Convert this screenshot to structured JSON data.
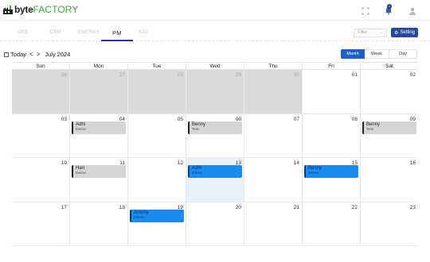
{
  "header": {
    "logo_a": "byte",
    "logo_b": "FACTORY",
    "notification_count": "1"
  },
  "nav": {
    "tabs": [
      "OEE",
      "CBM",
      "ENERGY",
      "PM",
      "SJC"
    ],
    "active_tab": "PM",
    "filter_label": "Filter",
    "setting_label": "Setting"
  },
  "toolbar": {
    "today_label": "Today",
    "prev_label": "<",
    "next_label": ">",
    "month_label": "July 2024",
    "views": [
      "Month",
      "Week",
      "Day"
    ],
    "active_view": "Month"
  },
  "calendar": {
    "weekdays": [
      "Sun",
      "Mon",
      "Tue",
      "Wed",
      "Thu",
      "Fri",
      "Sat"
    ],
    "weeks": [
      [
        {
          "n": "26",
          "other": true
        },
        {
          "n": "27",
          "other": true
        },
        {
          "n": "28",
          "other": true
        },
        {
          "n": "29",
          "other": true
        },
        {
          "n": "30",
          "other": true
        },
        {
          "n": "01"
        },
        {
          "n": "02"
        }
      ],
      [
        {
          "n": "03"
        },
        {
          "n": "04",
          "event": {
            "name": "Adhi",
            "sub": "Demo",
            "color": "gray"
          }
        },
        {
          "n": "05"
        },
        {
          "n": "06",
          "event": {
            "name": "Benny",
            "sub": "Test",
            "color": "gray"
          }
        },
        {
          "n": "07"
        },
        {
          "n": "08"
        },
        {
          "n": "09",
          "event": {
            "name": "Benny",
            "sub": "Test",
            "color": "gray"
          }
        }
      ],
      [
        {
          "n": "10"
        },
        {
          "n": "11",
          "event": {
            "name": "Hari",
            "sub": "Demo",
            "color": "gray"
          }
        },
        {
          "n": "12"
        },
        {
          "n": "13",
          "today": true,
          "event": {
            "name": "Adhi",
            "sub": "Demo",
            "color": "blue"
          }
        },
        {
          "n": "14"
        },
        {
          "n": "15",
          "event": {
            "name": "Benny",
            "sub": "Demo",
            "color": "blue"
          }
        },
        {
          "n": "16"
        }
      ],
      [
        {
          "n": "17"
        },
        {
          "n": "18"
        },
        {
          "n": "19",
          "event": {
            "name": "Antony",
            "sub": "Demo",
            "color": "blue"
          }
        },
        {
          "n": "20"
        },
        {
          "n": "21"
        },
        {
          "n": "22"
        },
        {
          "n": "23"
        }
      ]
    ]
  },
  "colors": {
    "brand_green": "#3ea83a",
    "accent_blue": "#1f5fcc",
    "setting_blue": "#244a9c",
    "event_blue": "#1a8cf0",
    "event_gray": "#d5d5d5",
    "other_month_gray": "#dadada",
    "today_bg": "#e6f3fd"
  },
  "icons": {
    "logo": "factory-icon",
    "fullscreen": "fullscreen-icon",
    "notifications": "bell-icon",
    "user": "user-icon",
    "calendar": "calendar-icon",
    "settings": "gear-icon"
  }
}
